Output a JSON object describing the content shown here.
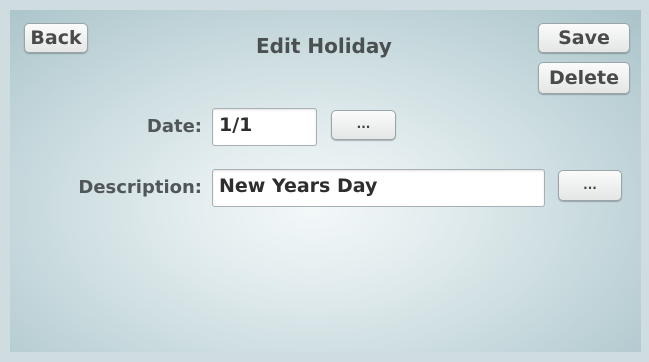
{
  "header": {
    "back_label": "Back",
    "title": "Edit Holiday",
    "save_label": "Save",
    "delete_label": "Delete"
  },
  "form": {
    "date_label": "Date:",
    "date_value": "1/1",
    "date_picker_label": "...",
    "description_label": "Description:",
    "description_value": "New Years Day",
    "description_picker_label": "..."
  }
}
